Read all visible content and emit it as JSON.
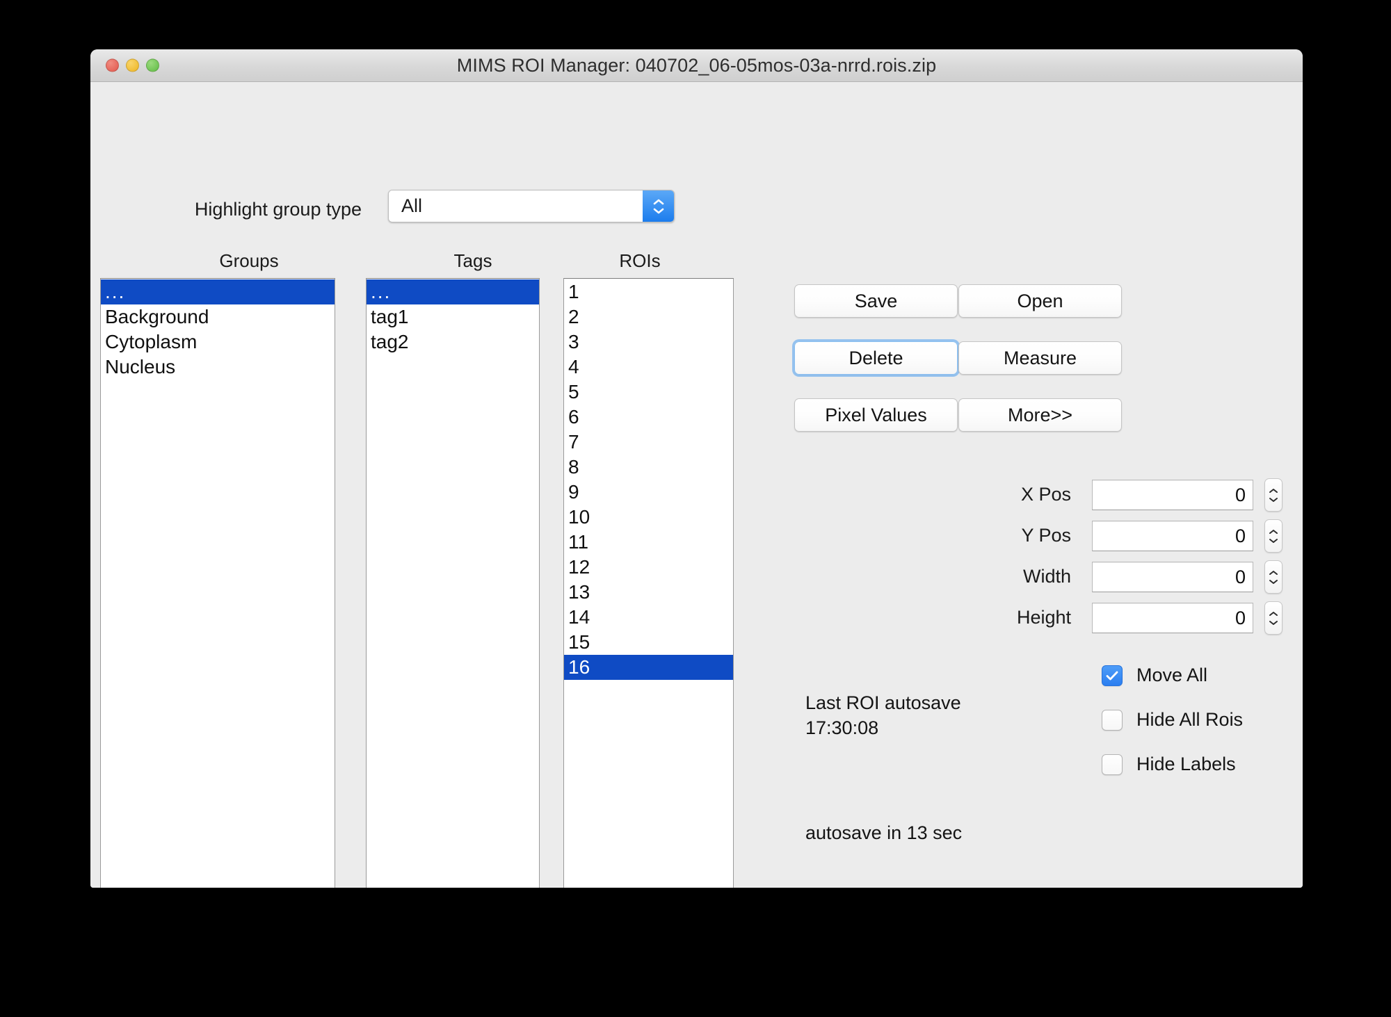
{
  "window": {
    "title": "MIMS ROI Manager: 040702_06-05mos-03a-nrrd.rois.zip",
    "traffic_lights": {
      "close": "close-button",
      "minimize": "minimize-button",
      "zoom": "zoom-button"
    },
    "colors": {
      "chrome": "#ececec",
      "selection_blue": "#0f4bc4",
      "checkbox_blue": "#2b7ef0",
      "focus_ring": "#8cc0f0",
      "light_red": "#e2564b",
      "light_yellow": "#eeb521",
      "light_green": "#5fbb43"
    }
  },
  "highlight": {
    "label": "Highlight group type",
    "selected": "All",
    "options": [
      "All"
    ]
  },
  "columns": {
    "groups_title": "Groups",
    "tags_title": "Tags",
    "rois_title": "ROIs"
  },
  "groups": {
    "items": [
      "...",
      "Background",
      "Cytoplasm",
      "Nucleus"
    ],
    "selected_index": 0
  },
  "tags": {
    "items": [
      "...",
      "tag1",
      "tag2"
    ],
    "selected_index": 0
  },
  "rois": {
    "items": [
      "1",
      "2",
      "3",
      "4",
      "5",
      "6",
      "7",
      "8",
      "9",
      "10",
      "11",
      "12",
      "13",
      "14",
      "15",
      "16"
    ],
    "selected_index": 15
  },
  "buttons": {
    "save": "Save",
    "open": "Open",
    "delete": "Delete",
    "measure": "Measure",
    "pixel_values": "Pixel Values",
    "more": "More>>"
  },
  "fields": {
    "x_pos": {
      "label": "X Pos",
      "value": "0"
    },
    "y_pos": {
      "label": "Y Pos",
      "value": "0"
    },
    "width": {
      "label": "Width",
      "value": "0"
    },
    "height": {
      "label": "Height",
      "value": "0"
    }
  },
  "checkboxes": {
    "move_all": {
      "label": "Move All",
      "checked": true
    },
    "hide_all_rois": {
      "label": "Hide All Rois",
      "checked": false
    },
    "hide_labels": {
      "label": "Hide Labels",
      "checked": false
    }
  },
  "status": {
    "last_autosave_label": "Last ROI autosave",
    "last_autosave_time": "17:30:08",
    "next_autosave": "autosave in 13 sec"
  }
}
